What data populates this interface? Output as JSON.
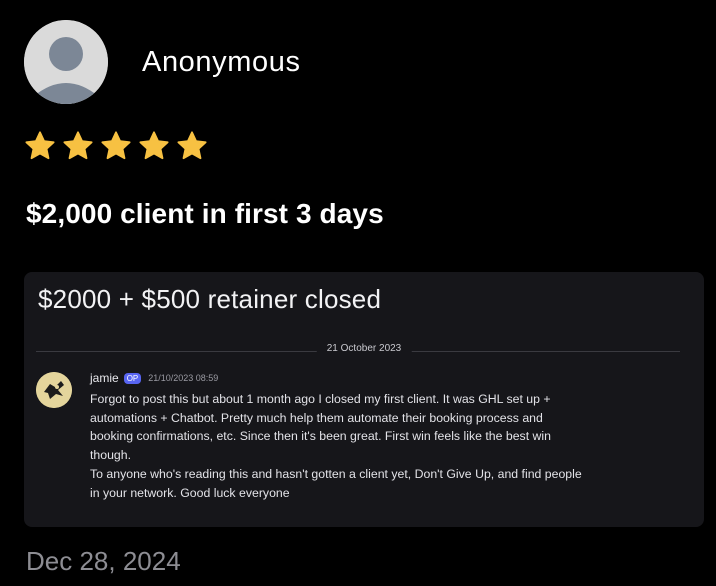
{
  "review": {
    "author": "Anonymous",
    "rating": 5,
    "rating_max": 5,
    "title": "$2,000 client in first 3 days",
    "date": "Dec 28, 2024"
  },
  "screenshot": {
    "thread_title": "$2000 + $500 retainer closed",
    "date_separator": "21 October 2023",
    "message": {
      "author": "jamie",
      "badge": "OP",
      "timestamp": "21/10/2023 08:59",
      "body": "Forgot to post this but about 1 month ago I closed my first client. It was GHL set up +\nautomations + Chatbot. Pretty much help them automate their booking process and\nbooking confirmations, etc. Since then it's been great. First win feels like the best win\nthough.\nTo anyone who's reading this and hasn't gotten a client yet, Don't Give Up, and find people\nin your network. Good luck everyone"
    }
  },
  "colors": {
    "background": "#000000",
    "star": "#f7c142",
    "op_badge": "#5865f2",
    "muted_text": "#8d8d93"
  },
  "icons": [
    "default-avatar-icon",
    "star-icon",
    "user-avatar-icon"
  ]
}
